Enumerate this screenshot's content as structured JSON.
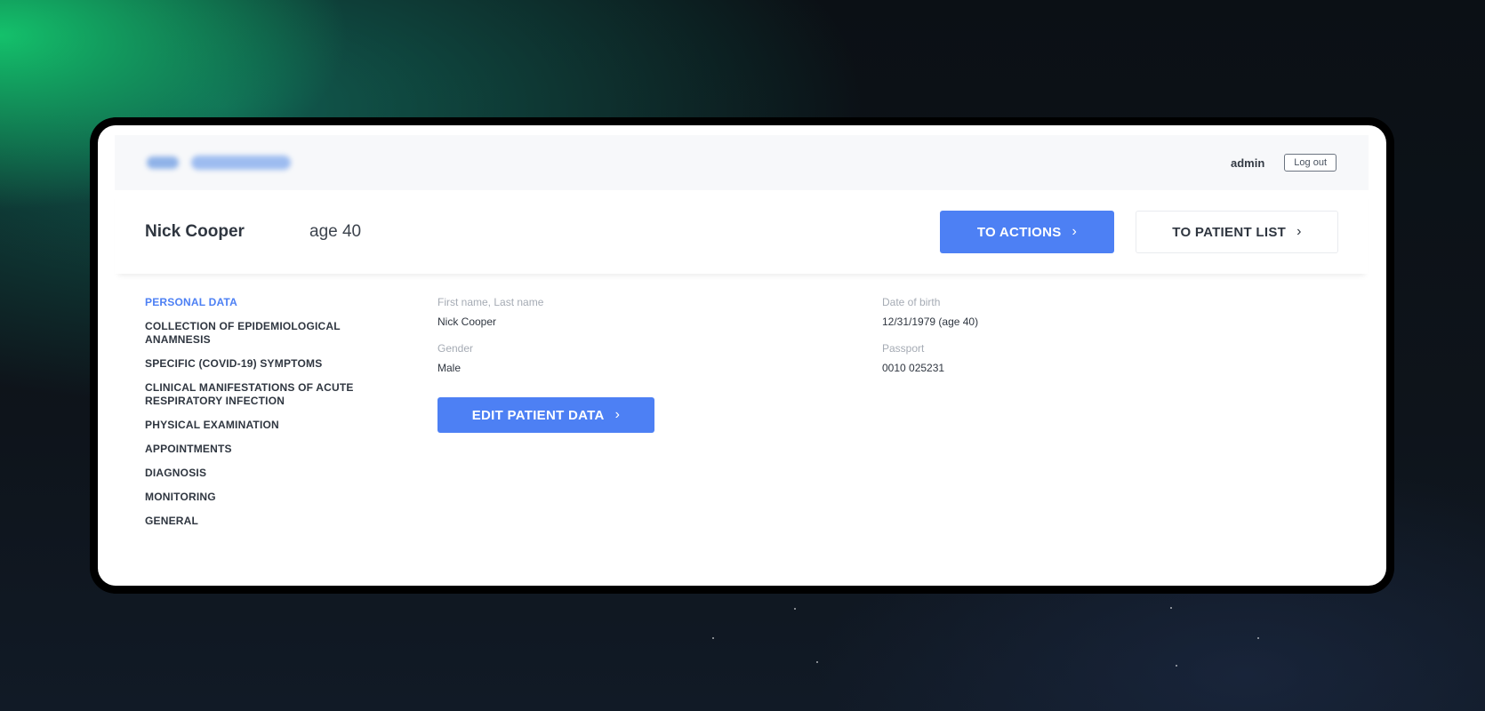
{
  "topbar": {
    "username": "admin",
    "logout_label": "Log out"
  },
  "patient": {
    "name": "Nick Cooper",
    "age": "age 40",
    "to_actions_label": "TO ACTIONS",
    "to_patient_list_label": "TO PATIENT LIST"
  },
  "sidebar": {
    "items": [
      {
        "label": "PERSONAL DATA"
      },
      {
        "label": "COLLECTION OF EPIDEMIOLOGICAL ANAMNESIS"
      },
      {
        "label": "SPECIFIC (COVID-19) SYMPTOMS"
      },
      {
        "label": "CLINICAL MANIFESTATIONS OF ACUTE RESPIRATORY INFECTION"
      },
      {
        "label": "PHYSICAL EXAMINATION"
      },
      {
        "label": "APPOINTMENTS"
      },
      {
        "label": "DIAGNOSIS"
      },
      {
        "label": "MONITORING"
      },
      {
        "label": "GENERAL"
      }
    ],
    "active_index": 0
  },
  "personal_data": {
    "full_name_label": "First name, Last name",
    "full_name_value": "Nick Cooper",
    "gender_label": "Gender",
    "gender_value": "Male",
    "dob_label": "Date of birth",
    "dob_value": "12/31/1979 (age 40)",
    "passport_label": "Passport",
    "passport_value": "0010 025231",
    "edit_label": "EDIT PATIENT DATA"
  },
  "colors": {
    "accent": "#4d80f4",
    "text_primary": "#2f3640",
    "text_muted": "#a5abb4",
    "background_green": "#14c86e"
  },
  "icons": {
    "chevron": "chevron-right-icon"
  }
}
